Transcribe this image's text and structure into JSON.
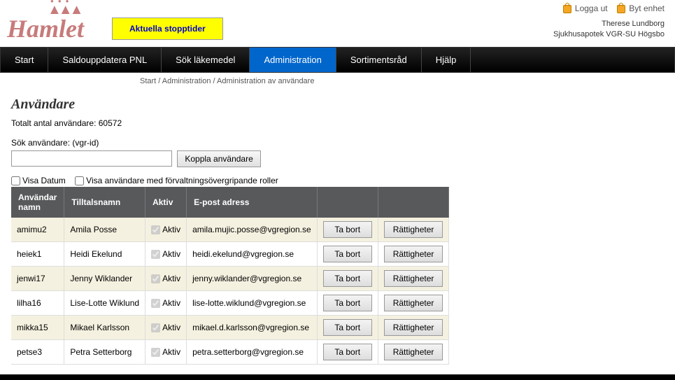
{
  "logo": "Hamlet",
  "header": {
    "stopptider_label": "Aktuella stopptider",
    "logout_label": "Logga ut",
    "change_device_label": "Byt enhet",
    "user_name": "Therese Lundborg",
    "unit_name": "Sjukhusapotek VGR-SU Högsbo"
  },
  "nav": {
    "items": [
      {
        "label": "Start"
      },
      {
        "label": "Saldouppdatera PNL"
      },
      {
        "label": "Sök läkemedel"
      },
      {
        "label": "Administration"
      },
      {
        "label": "Sortimentsråd"
      },
      {
        "label": "Hjälp"
      }
    ],
    "active_index": 3
  },
  "breadcrumb": "Start / Administration / Administration av användare",
  "page": {
    "title": "Användare",
    "total_label": "Totalt antal användare: 60572",
    "search_label": "Sök användare: (vgr-id)",
    "koppla_btn": "Koppla användare",
    "visa_datum_label": "Visa Datum",
    "visa_roller_label": "Visa användare med förvaltningsövergripande roller"
  },
  "table": {
    "headers": {
      "username": "Användar namn",
      "tilltalsnamn": "Tilltalsnamn",
      "aktiv": "Aktiv",
      "epost": "E-post adress"
    },
    "aktiv_label": "Aktiv",
    "ta_bort_label": "Ta bort",
    "rattigheter_label": "Rättigheter",
    "rows": [
      {
        "username": "amimu2",
        "name": "Amila Posse",
        "aktiv": true,
        "email": "amila.mujic.posse@vgregion.se"
      },
      {
        "username": "heiek1",
        "name": "Heidi Ekelund",
        "aktiv": true,
        "email": "heidi.ekelund@vgregion.se"
      },
      {
        "username": "jenwi17",
        "name": "Jenny Wiklander",
        "aktiv": true,
        "email": "jenny.wiklander@vgregion.se"
      },
      {
        "username": "lilha16",
        "name": "Lise-Lotte Wiklund",
        "aktiv": true,
        "email": "lise-lotte.wiklund@vgregion.se"
      },
      {
        "username": "mikka15",
        "name": "Mikael Karlsson",
        "aktiv": true,
        "email": "mikael.d.karlsson@vgregion.se"
      },
      {
        "username": "petse3",
        "name": "Petra Setterborg",
        "aktiv": true,
        "email": "petra.setterborg@vgregion.se"
      }
    ]
  }
}
